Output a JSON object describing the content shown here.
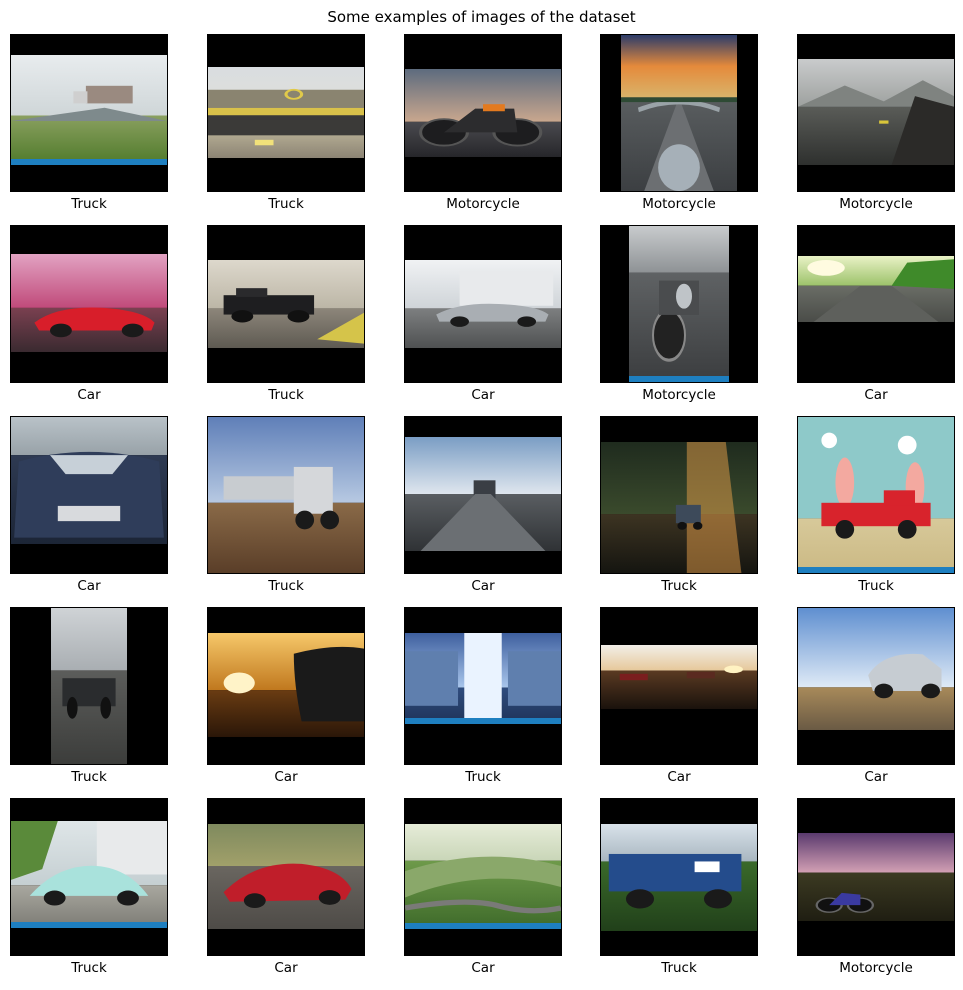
{
  "title": "Some examples of images of the dataset",
  "grid": [
    [
      {
        "label": "Truck",
        "scene": "truck-on-road-overcast",
        "watermark": "shutterstock"
      },
      {
        "label": "Truck",
        "scene": "noon-warehouse-building"
      },
      {
        "label": "Motorcycle",
        "scene": "orange-dirt-motorcycle-dusk"
      },
      {
        "label": "Motorcycle",
        "scene": "motorcycle-handlebar-sunset"
      },
      {
        "label": "Motorcycle",
        "scene": "misty-mountain-rocks"
      }
    ],
    [
      {
        "label": "Car",
        "scene": "red-supercar-neon"
      },
      {
        "label": "Truck",
        "scene": "classic-pickup-truck"
      },
      {
        "label": "Car",
        "scene": "silver-classic-car"
      },
      {
        "label": "Motorcycle",
        "scene": "parked-cruiser-motorcycle",
        "watermark": "shutterstock"
      },
      {
        "label": "Car",
        "scene": "sunlit-forest-road"
      }
    ],
    [
      {
        "label": "Car",
        "scene": "blue-bmw-front"
      },
      {
        "label": "Truck",
        "scene": "road-train-dirt-road"
      },
      {
        "label": "Car",
        "scene": "truck-on-highway-clouds"
      },
      {
        "label": "Truck",
        "scene": "truck-in-dark-forest"
      },
      {
        "label": "Truck",
        "scene": "red-pickup-cartoon",
        "watermark": "shutterstock"
      }
    ],
    [
      {
        "label": "Truck",
        "scene": "black-pickup-gravel"
      },
      {
        "label": "Car",
        "scene": "car-silhouette-sunset"
      },
      {
        "label": "Truck",
        "scene": "truck-grille-blue",
        "watermark": "shutterstock"
      },
      {
        "label": "Car",
        "scene": "cars-highway-sunset"
      },
      {
        "label": "Car",
        "scene": "silver-suv-sky"
      }
    ],
    [
      {
        "label": "Truck",
        "scene": "mint-beetle-street",
        "watermark": "shutterstock"
      },
      {
        "label": "Car",
        "scene": "red-sportscar-road"
      },
      {
        "label": "Car",
        "scene": "green-valley-road",
        "watermark": "shutterstock"
      },
      {
        "label": "Truck",
        "scene": "blue-pickup-grass"
      },
      {
        "label": "Motorcycle",
        "scene": "dirtbike-purple-sky"
      }
    ]
  ],
  "colors": {
    "frame": "#000000",
    "watermark_bar": "#1e7fc0"
  }
}
